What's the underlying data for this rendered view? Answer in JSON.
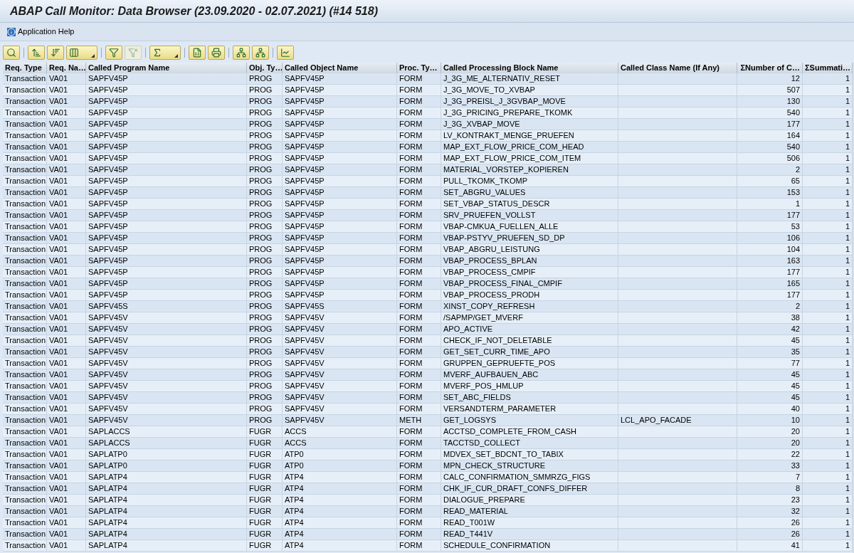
{
  "window": {
    "title": "ABAP Call Monitor: Data Browser (23.09.2020 - 02.07.2021) (#14 518)"
  },
  "menu": [
    {
      "label": "Application Help"
    }
  ],
  "toolbar": [
    {
      "buttons": [
        {
          "kind": "details",
          "disabled": false,
          "dropdown": false
        }
      ]
    },
    {
      "buttons": [
        {
          "kind": "sort_up",
          "disabled": false,
          "dropdown": false
        },
        {
          "kind": "sort_down",
          "disabled": false,
          "dropdown": false
        },
        {
          "kind": "layout",
          "disabled": false,
          "dropdown": true
        }
      ]
    },
    {
      "buttons": [
        {
          "kind": "filter",
          "disabled": false,
          "dropdown": false
        },
        {
          "kind": "filter_off",
          "disabled": true,
          "dropdown": false
        }
      ]
    },
    {
      "buttons": [
        {
          "kind": "sum",
          "disabled": false,
          "dropdown": true
        }
      ]
    },
    {
      "buttons": [
        {
          "kind": "excel",
          "disabled": false,
          "dropdown": false
        },
        {
          "kind": "print",
          "disabled": false,
          "dropdown": false
        }
      ]
    },
    {
      "buttons": [
        {
          "kind": "tree_up",
          "disabled": false,
          "dropdown": false
        },
        {
          "kind": "tree_down",
          "disabled": false,
          "dropdown": false
        }
      ]
    },
    {
      "buttons": [
        {
          "kind": "chart",
          "disabled": false,
          "dropdown": false
        }
      ]
    }
  ],
  "table": {
    "columns": [
      {
        "label": "Req. Type"
      },
      {
        "label": "Req. Na…"
      },
      {
        "label": "Called Program Name"
      },
      {
        "label": "Obj. Ty…"
      },
      {
        "label": "Called Object Name"
      },
      {
        "label": "Proc. Ty…"
      },
      {
        "label": "Called Processing Block Name"
      },
      {
        "label": "Called Class Name (If Any)"
      },
      {
        "label": "ΣNumber of C…"
      },
      {
        "label": "ΣSummati…"
      }
    ],
    "rows": [
      {
        "cells": [
          "Transaction",
          "VA01",
          "SAPFV45P",
          "PROG",
          "SAPFV45P",
          "FORM",
          "J_3G_ME_ALTERNATIV_RESET",
          null,
          "12",
          "1"
        ]
      },
      {
        "cells": [
          "Transaction",
          "VA01",
          "SAPFV45P",
          "PROG",
          "SAPFV45P",
          "FORM",
          "J_3G_MOVE_TO_XVBAP",
          null,
          "507",
          "1"
        ]
      },
      {
        "cells": [
          "Transaction",
          "VA01",
          "SAPFV45P",
          "PROG",
          "SAPFV45P",
          "FORM",
          "J_3G_PREISL_J_3GVBAP_MOVE",
          null,
          "130",
          "1"
        ]
      },
      {
        "cells": [
          "Transaction",
          "VA01",
          "SAPFV45P",
          "PROG",
          "SAPFV45P",
          "FORM",
          "J_3G_PRICING_PREPARE_TKOMK",
          null,
          "540",
          "1"
        ]
      },
      {
        "cells": [
          "Transaction",
          "VA01",
          "SAPFV45P",
          "PROG",
          "SAPFV45P",
          "FORM",
          "J_3G_XVBAP_MOVE",
          null,
          "177",
          "1"
        ]
      },
      {
        "cells": [
          "Transaction",
          "VA01",
          "SAPFV45P",
          "PROG",
          "SAPFV45P",
          "FORM",
          "LV_KONTRAKT_MENGE_PRUEFEN",
          null,
          "164",
          "1"
        ]
      },
      {
        "cells": [
          "Transaction",
          "VA01",
          "SAPFV45P",
          "PROG",
          "SAPFV45P",
          "FORM",
          "MAP_EXT_FLOW_PRICE_COM_HEAD",
          null,
          "540",
          "1"
        ]
      },
      {
        "cells": [
          "Transaction",
          "VA01",
          "SAPFV45P",
          "PROG",
          "SAPFV45P",
          "FORM",
          "MAP_EXT_FLOW_PRICE_COM_ITEM",
          null,
          "506",
          "1"
        ]
      },
      {
        "cells": [
          "Transaction",
          "VA01",
          "SAPFV45P",
          "PROG",
          "SAPFV45P",
          "FORM",
          "MATERIAL_VORSTEP_KOPIEREN",
          null,
          "2",
          "1"
        ]
      },
      {
        "cells": [
          "Transaction",
          "VA01",
          "SAPFV45P",
          "PROG",
          "SAPFV45P",
          "FORM",
          "PULL_TKOMK_TKOMP",
          null,
          "65",
          "1"
        ]
      },
      {
        "cells": [
          "Transaction",
          "VA01",
          "SAPFV45P",
          "PROG",
          "SAPFV45P",
          "FORM",
          "SET_ABGRU_VALUES",
          null,
          "153",
          "1"
        ]
      },
      {
        "cells": [
          "Transaction",
          "VA01",
          "SAPFV45P",
          "PROG",
          "SAPFV45P",
          "FORM",
          "SET_VBAP_STATUS_DESCR",
          null,
          "1",
          "1"
        ]
      },
      {
        "cells": [
          "Transaction",
          "VA01",
          "SAPFV45P",
          "PROG",
          "SAPFV45P",
          "FORM",
          "SRV_PRUEFEN_VOLLST",
          null,
          "177",
          "1"
        ]
      },
      {
        "cells": [
          "Transaction",
          "VA01",
          "SAPFV45P",
          "PROG",
          "SAPFV45P",
          "FORM",
          "VBAP-CMKUA_FUELLEN_ALLE",
          null,
          "53",
          "1"
        ]
      },
      {
        "cells": [
          "Transaction",
          "VA01",
          "SAPFV45P",
          "PROG",
          "SAPFV45P",
          "FORM",
          "VBAP-PSTYV_PRUEFEN_SD_DP",
          null,
          "106",
          "1"
        ]
      },
      {
        "cells": [
          "Transaction",
          "VA01",
          "SAPFV45P",
          "PROG",
          "SAPFV45P",
          "FORM",
          "VBAP_ABGRU_LEISTUNG",
          null,
          "104",
          "1"
        ]
      },
      {
        "cells": [
          "Transaction",
          "VA01",
          "SAPFV45P",
          "PROG",
          "SAPFV45P",
          "FORM",
          "VBAP_PROCESS_BPLAN",
          null,
          "163",
          "1"
        ]
      },
      {
        "cells": [
          "Transaction",
          "VA01",
          "SAPFV45P",
          "PROG",
          "SAPFV45P",
          "FORM",
          "VBAP_PROCESS_CMPIF",
          null,
          "177",
          "1"
        ]
      },
      {
        "cells": [
          "Transaction",
          "VA01",
          "SAPFV45P",
          "PROG",
          "SAPFV45P",
          "FORM",
          "VBAP_PROCESS_FINAL_CMPIF",
          null,
          "165",
          "1"
        ]
      },
      {
        "cells": [
          "Transaction",
          "VA01",
          "SAPFV45P",
          "PROG",
          "SAPFV45P",
          "FORM",
          "VBAP_PROCESS_PRODH",
          null,
          "177",
          "1"
        ]
      },
      {
        "cells": [
          "Transaction",
          "VA01",
          "SAPFV45S",
          "PROG",
          "SAPFV45S",
          "FORM",
          "XINST_COPY_REFRESH",
          null,
          "2",
          "1"
        ]
      },
      {
        "cells": [
          "Transaction",
          "VA01",
          "SAPFV45V",
          "PROG",
          "SAPFV45V",
          "FORM",
          "/SAPMP/GET_MVERF",
          null,
          "38",
          "1"
        ]
      },
      {
        "cells": [
          "Transaction",
          "VA01",
          "SAPFV45V",
          "PROG",
          "SAPFV45V",
          "FORM",
          "APO_ACTIVE",
          null,
          "42",
          "1"
        ]
      },
      {
        "cells": [
          "Transaction",
          "VA01",
          "SAPFV45V",
          "PROG",
          "SAPFV45V",
          "FORM",
          "CHECK_IF_NOT_DELETABLE",
          null,
          "45",
          "1"
        ]
      },
      {
        "cells": [
          "Transaction",
          "VA01",
          "SAPFV45V",
          "PROG",
          "SAPFV45V",
          "FORM",
          "GET_SET_CURR_TIME_APO",
          null,
          "35",
          "1"
        ]
      },
      {
        "cells": [
          "Transaction",
          "VA01",
          "SAPFV45V",
          "PROG",
          "SAPFV45V",
          "FORM",
          "GRUPPEN_GEPRUEFTE_POS",
          null,
          "77",
          "1"
        ]
      },
      {
        "cells": [
          "Transaction",
          "VA01",
          "SAPFV45V",
          "PROG",
          "SAPFV45V",
          "FORM",
          "MVERF_AUFBAUEN_ABC",
          null,
          "45",
          "1"
        ]
      },
      {
        "cells": [
          "Transaction",
          "VA01",
          "SAPFV45V",
          "PROG",
          "SAPFV45V",
          "FORM",
          "MVERF_POS_HMLUP",
          null,
          "45",
          "1"
        ]
      },
      {
        "cells": [
          "Transaction",
          "VA01",
          "SAPFV45V",
          "PROG",
          "SAPFV45V",
          "FORM",
          "SET_ABC_FIELDS",
          null,
          "45",
          "1"
        ]
      },
      {
        "cells": [
          "Transaction",
          "VA01",
          "SAPFV45V",
          "PROG",
          "SAPFV45V",
          "FORM",
          "VERSANDTERM_PARAMETER",
          null,
          "40",
          "1"
        ]
      },
      {
        "cells": [
          "Transaction",
          "VA01",
          "SAPFV45V",
          "PROG",
          "SAPFV45V",
          "METH",
          "GET_LOGSYS",
          "LCL_APO_FACADE",
          "10",
          "1"
        ]
      },
      {
        "cells": [
          "Transaction",
          "VA01",
          "SAPLACCS",
          "FUGR",
          "ACCS",
          "FORM",
          "ACCTSD_COMPLETE_FROM_CASH",
          null,
          "20",
          "1"
        ]
      },
      {
        "cells": [
          "Transaction",
          "VA01",
          "SAPLACCS",
          "FUGR",
          "ACCS",
          "FORM",
          "TACCTSD_COLLECT",
          null,
          "20",
          "1"
        ]
      },
      {
        "cells": [
          "Transaction",
          "VA01",
          "SAPLATP0",
          "FUGR",
          "ATP0",
          "FORM",
          "MDVEX_SET_BDCNT_TO_TABIX",
          null,
          "22",
          "1"
        ]
      },
      {
        "cells": [
          "Transaction",
          "VA01",
          "SAPLATP0",
          "FUGR",
          "ATP0",
          "FORM",
          "MPN_CHECK_STRUCTURE",
          null,
          "33",
          "1"
        ]
      },
      {
        "cells": [
          "Transaction",
          "VA01",
          "SAPLATP4",
          "FUGR",
          "ATP4",
          "FORM",
          "CALC_CONFIRMATION_SMMRZG_FIGS",
          null,
          "7",
          "1"
        ]
      },
      {
        "cells": [
          "Transaction",
          "VA01",
          "SAPLATP4",
          "FUGR",
          "ATP4",
          "FORM",
          "CHK_IF_CUR_DRAFT_CONFS_DIFFER",
          null,
          "8",
          "1"
        ]
      },
      {
        "cells": [
          "Transaction",
          "VA01",
          "SAPLATP4",
          "FUGR",
          "ATP4",
          "FORM",
          "DIALOGUE_PREPARE",
          null,
          "23",
          "1"
        ]
      },
      {
        "cells": [
          "Transaction",
          "VA01",
          "SAPLATP4",
          "FUGR",
          "ATP4",
          "FORM",
          "READ_MATERIAL",
          null,
          "32",
          "1"
        ]
      },
      {
        "cells": [
          "Transaction",
          "VA01",
          "SAPLATP4",
          "FUGR",
          "ATP4",
          "FORM",
          "READ_T001W",
          null,
          "26",
          "1"
        ]
      },
      {
        "cells": [
          "Transaction",
          "VA01",
          "SAPLATP4",
          "FUGR",
          "ATP4",
          "FORM",
          "READ_T441V",
          null,
          "26",
          "1"
        ]
      },
      {
        "cells": [
          "Transaction",
          "VA01",
          "SAPLATP4",
          "FUGR",
          "ATP4",
          "FORM",
          "SCHEDULE_CONFIRMATION",
          null,
          "41",
          "1"
        ]
      }
    ]
  }
}
